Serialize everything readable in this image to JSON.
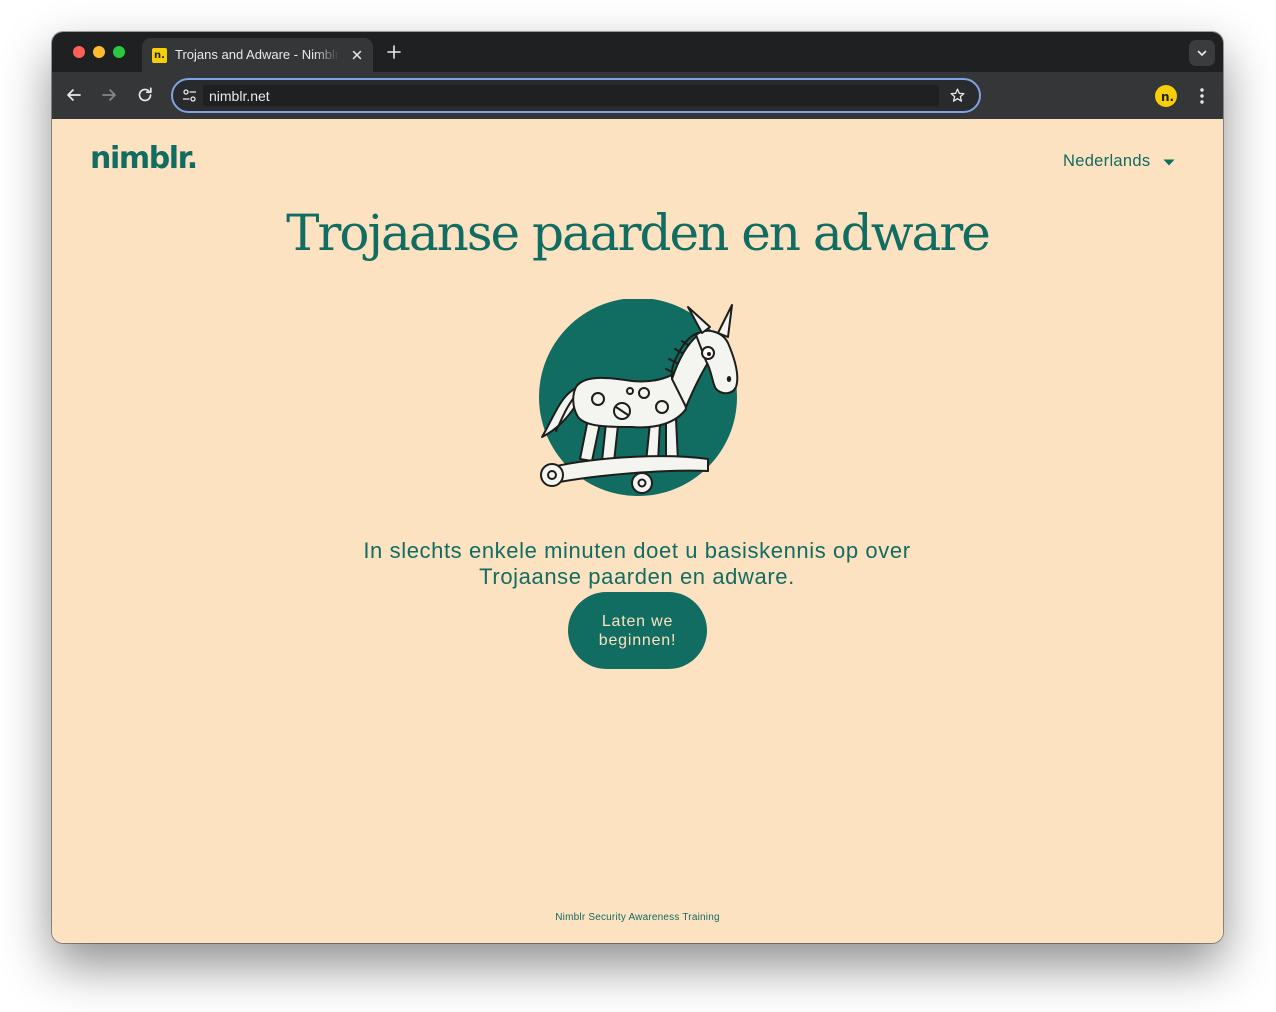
{
  "browser": {
    "tab": {
      "title": "Trojans and Adware - Nimblr Security Awareness Training",
      "favicon_text": "n."
    },
    "address_bar": {
      "url": "nimblr.net"
    },
    "profile_initial": "n."
  },
  "page": {
    "logo": "nimblr.",
    "language": "Nederlands",
    "title": "Trojaanse paarden en adware",
    "intro": "In slechts enkele minuten doet u basiskennis op over Trojaanse paarden en adware.",
    "start_button": "Laten we beginnen!",
    "footer": "Nimblr Security Awareness Training"
  },
  "colors": {
    "brand_green": "#116c61",
    "background": "#fde2c2",
    "accent_yellow": "#f7cf08"
  },
  "icons": [
    "back-icon",
    "forward-icon",
    "reload-icon",
    "tune-icon",
    "star-icon",
    "menu-dots-icon",
    "chevron-down-icon",
    "close-icon",
    "plus-icon"
  ]
}
